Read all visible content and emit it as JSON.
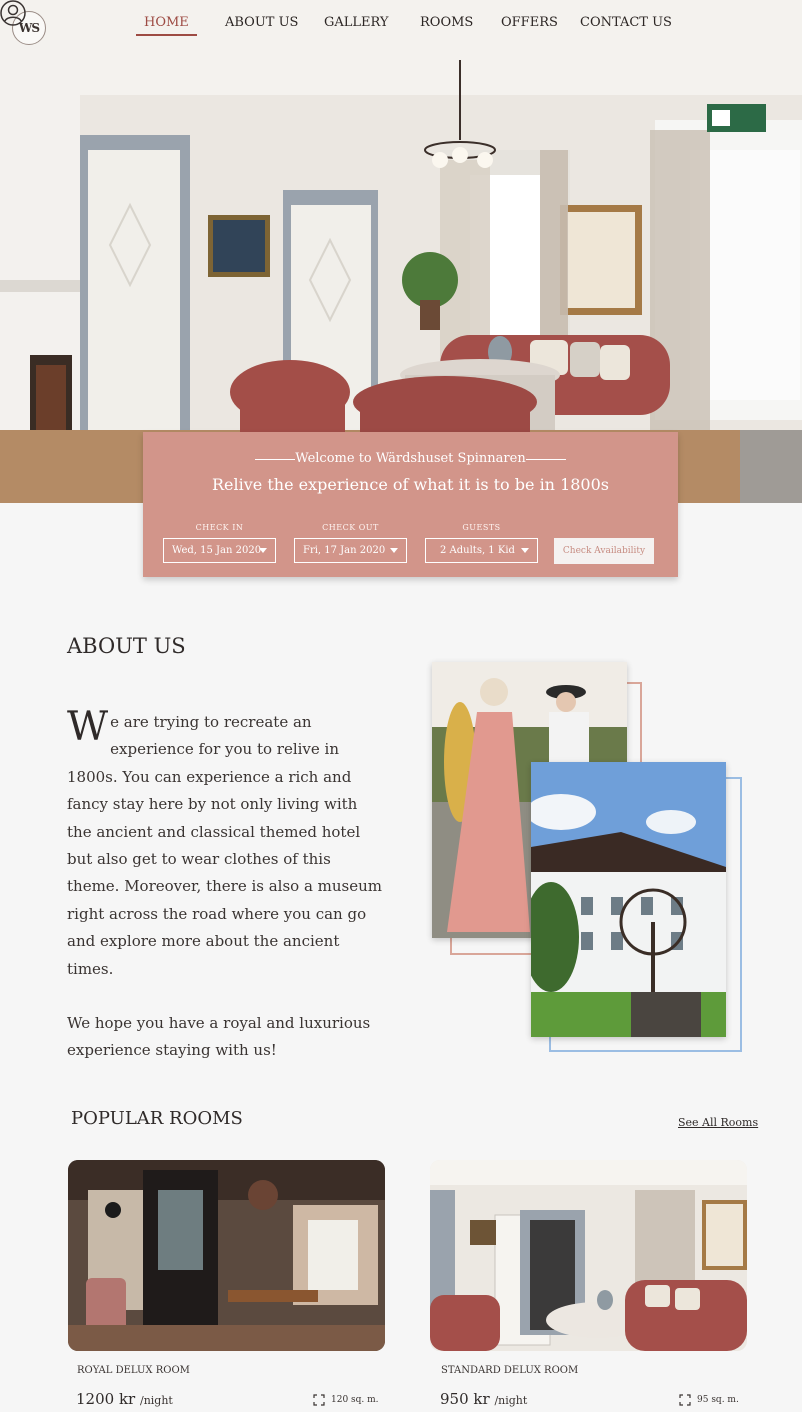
{
  "nav": {
    "logo": "WS",
    "items": [
      {
        "label": "HOME",
        "active": true
      },
      {
        "label": "ABOUT US",
        "active": false
      },
      {
        "label": "GALLERY",
        "active": false
      },
      {
        "label": "ROOMS",
        "active": false
      },
      {
        "label": "OFFERS",
        "active": false
      },
      {
        "label": "CONTACT US",
        "active": false
      }
    ],
    "user_icon": "user-circle-icon"
  },
  "booking": {
    "welcome": "Welcome to Wärdshuset Spinnaren",
    "tagline": "Relive the experience of what it is to be in 1800s",
    "check_in_label": "CHECK IN",
    "check_in_value": "Wed, 15 Jan 2020",
    "check_out_label": "CHECK OUT",
    "check_out_value": "Fri, 17 Jan 2020",
    "guests_label": "GUESTS",
    "guests_value": "2 Adults, 1 Kid",
    "button": "Check Availability"
  },
  "about": {
    "title": "ABOUT US",
    "dropcap": "W",
    "paragraph1": "e are trying to recreate an experience for you to relive in 1800s. You can experience a rich and fancy stay here by not only living with the ancient and classical themed hotel but also get to wear clothes of this theme. Moreover, there is also a museum right across the road where you can go and explore more about the ancient times.",
    "paragraph2": "We hope you have a royal and luxurious experience staying with us!"
  },
  "rooms": {
    "title": "POPULAR ROOMS",
    "see_all": "See All Rooms",
    "items": [
      {
        "name": "ROYAL DELUX ROOM",
        "price": "1200 kr",
        "per": "/night",
        "size": "120 sq. m."
      },
      {
        "name": "STANDARD DELUX ROOM",
        "price": "950 kr",
        "per": "/night",
        "size": "95 sq. m."
      }
    ]
  },
  "colors": {
    "accent": "#d2958a",
    "nav_active": "#9d4b43",
    "frame_pink": "#d9a699",
    "frame_blue": "#9bbde3"
  }
}
